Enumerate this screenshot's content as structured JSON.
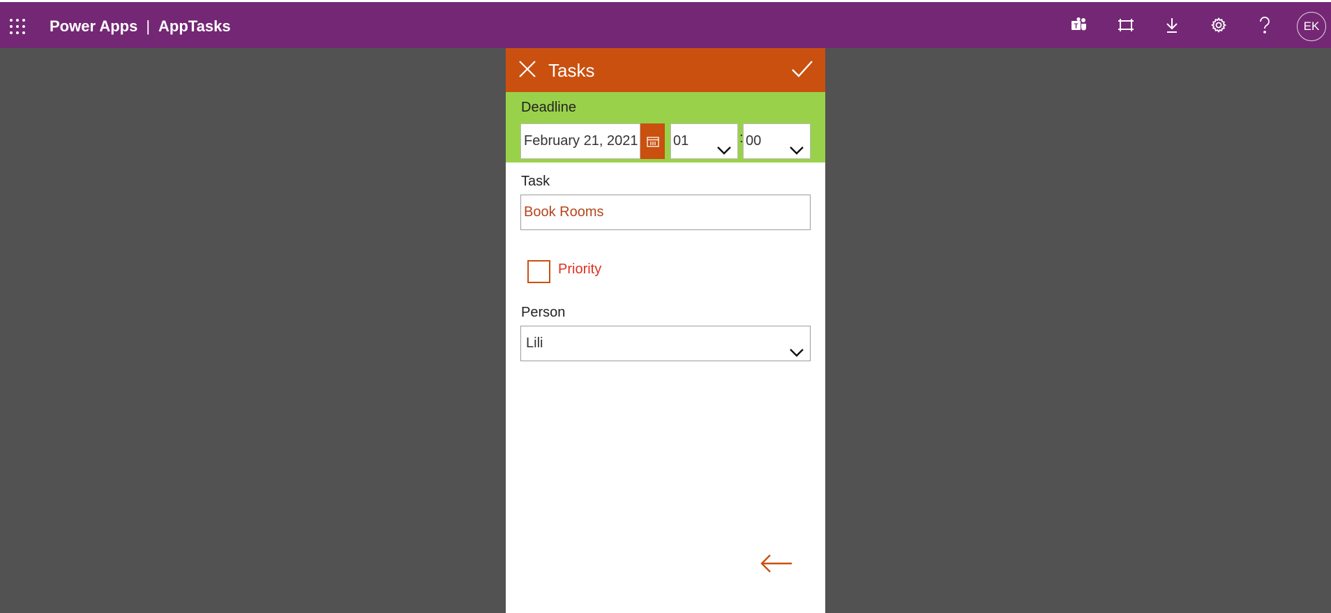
{
  "topbar": {
    "app_name": "Power Apps",
    "separator": "|",
    "app_title": "AppTasks",
    "icons": [
      "waffle-icon",
      "teams-icon",
      "fullscreen-icon",
      "download-icon",
      "gear-icon",
      "help-icon"
    ],
    "avatar_initials": "EK",
    "background": "#742774"
  },
  "form": {
    "header_title": "Tasks",
    "header_color": "#c9500f",
    "deadline": {
      "label": "Deadline",
      "date_value": "February 21, 2021",
      "hour_value": "01",
      "time_separator": ":",
      "minute_value": "00",
      "background": "#9ad14b"
    },
    "task": {
      "label": "Task",
      "value": "Book Rooms"
    },
    "priority": {
      "label": "Priority",
      "checked": false
    },
    "person": {
      "label": "Person",
      "value": "Lili"
    }
  }
}
